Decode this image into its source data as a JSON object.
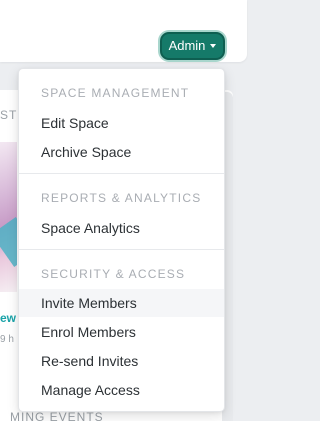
{
  "header": {
    "admin_button_label": "Admin"
  },
  "background": {
    "section_label_fragment": "ST",
    "link_fragment": "ew",
    "meta_fragment": "9 h",
    "bottom_label_fragment": "MING EVENTS"
  },
  "menu": {
    "sections": [
      {
        "header": "SPACE MANAGEMENT",
        "items": [
          {
            "label": "Edit Space"
          },
          {
            "label": "Archive Space"
          }
        ]
      },
      {
        "header": "REPORTS & ANALYTICS",
        "items": [
          {
            "label": "Space Analytics"
          }
        ]
      },
      {
        "header": "SECURITY & ACCESS",
        "items": [
          {
            "label": "Invite Members",
            "highlighted": true
          },
          {
            "label": "Enrol Members"
          },
          {
            "label": "Re-send Invites"
          },
          {
            "label": "Manage Access"
          }
        ]
      }
    ]
  },
  "colors": {
    "accent": "#157a69",
    "menu_header": "#a9adb3",
    "menu_text": "#2c3135"
  }
}
